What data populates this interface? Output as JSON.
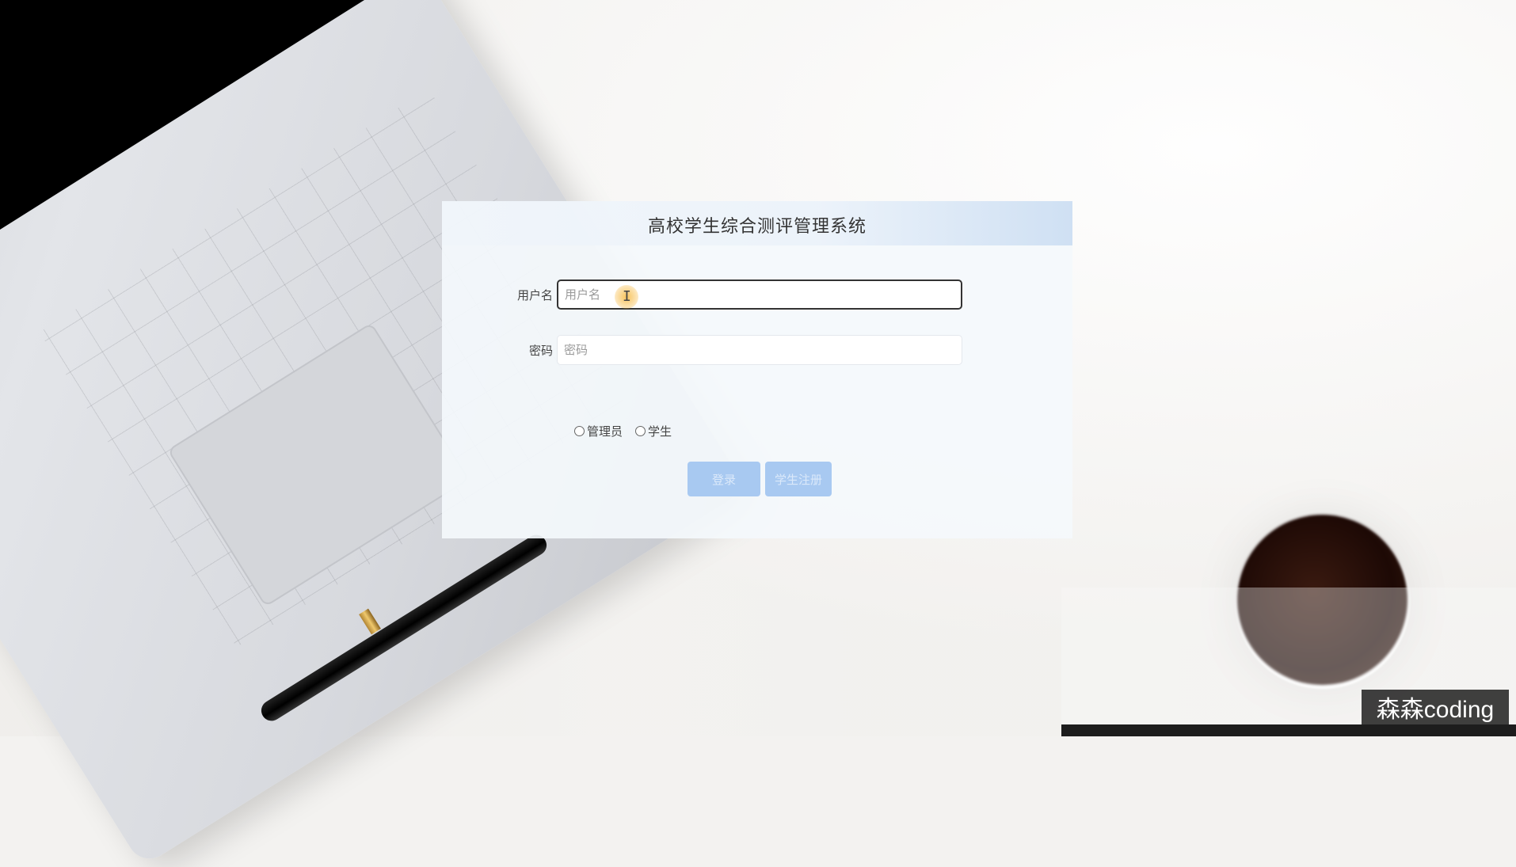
{
  "app": {
    "title": "高校学生综合测评管理系统"
  },
  "form": {
    "username": {
      "label": "用户名",
      "placeholder": "用户名",
      "value": ""
    },
    "password": {
      "label": "密码",
      "placeholder": "密码",
      "value": ""
    },
    "roles": [
      {
        "label": "管理员",
        "selected": false
      },
      {
        "label": "学生",
        "selected": false
      }
    ],
    "buttons": {
      "login": "登录",
      "register": "学生注册"
    }
  },
  "overlay": {
    "watermark": "森森coding"
  },
  "colors": {
    "button_bg": "#a8c9f1",
    "header_accent": "#cfe0f3"
  }
}
